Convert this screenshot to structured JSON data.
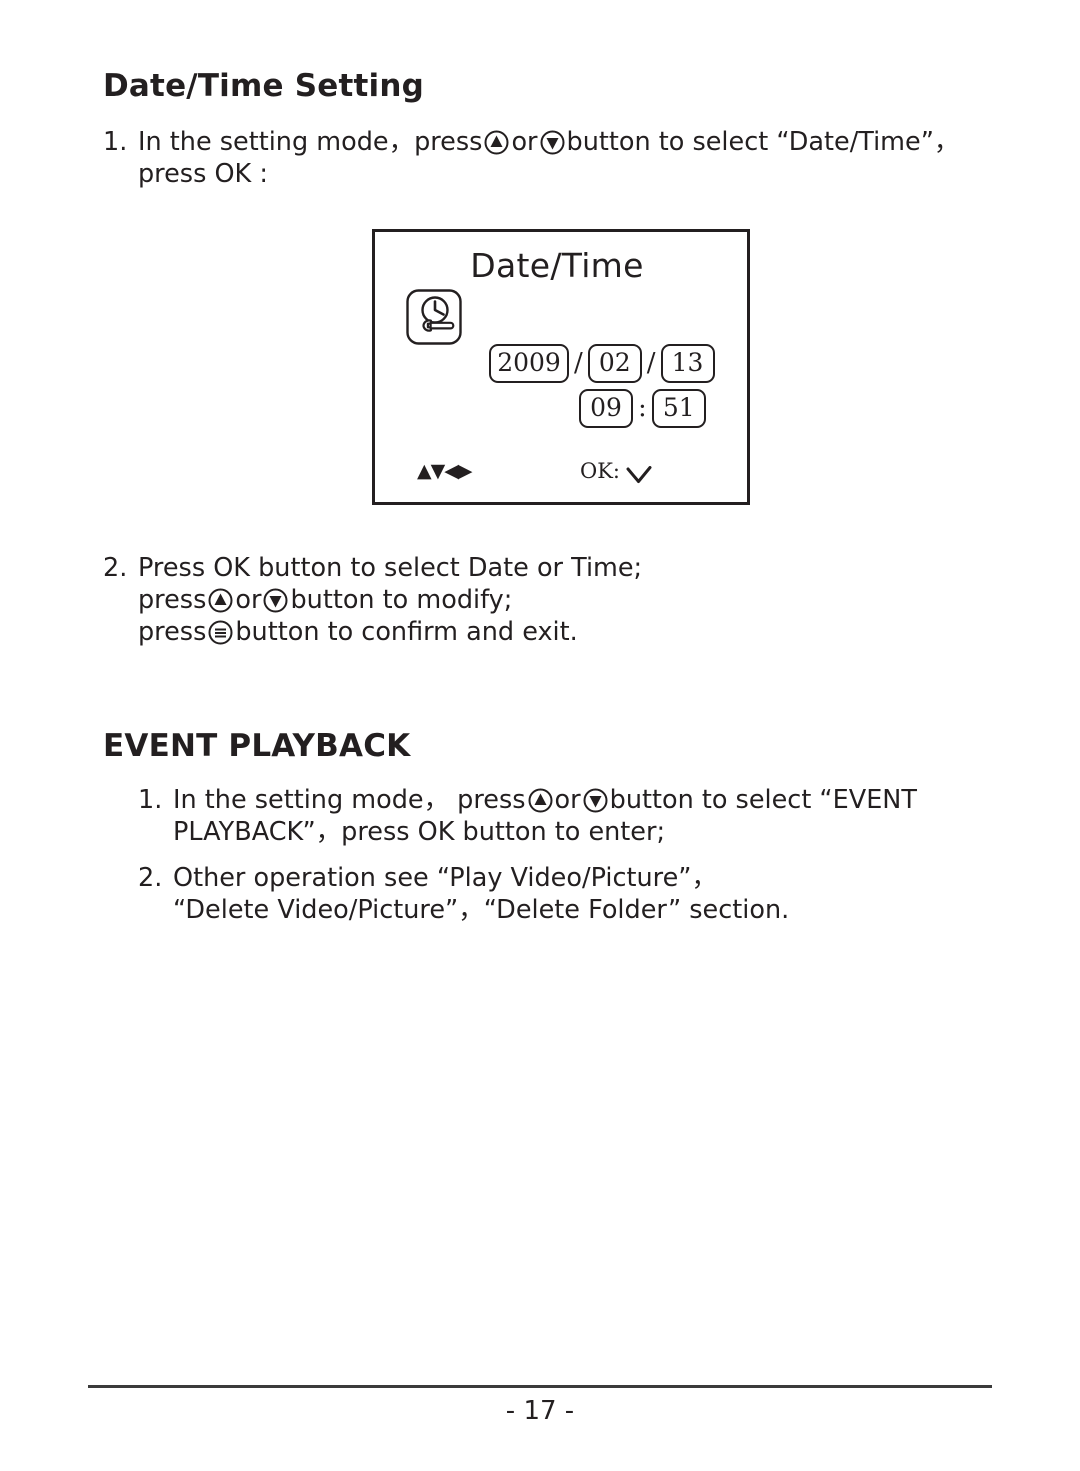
{
  "document": {
    "page_number": "- 17 -"
  },
  "sections": {
    "date_time": {
      "heading": "Date/Time Setting",
      "step1": {
        "number": "1.",
        "line1_a": "In the setting mode，press",
        "icon_up": "up-button-icon",
        "line1_b": "or",
        "icon_down": "down-button-icon",
        "line1_c": "button to select “Date/Time”，",
        "line2": "press OK :"
      },
      "step2": {
        "number": "2.",
        "line1": "Press OK button to select Date or Time;",
        "line2_a": "press",
        "line2_b": "or",
        "line2_c": "button to modify;",
        "line3_a": "press",
        "line3_b": "button to confirm and exit.",
        "icon_menu": "menu-button-icon"
      }
    },
    "event_playback": {
      "heading": "EVENT PLAYBACK",
      "step1": {
        "number": "1.",
        "line1_a": "In the setting mode， press",
        "line1_b": "or",
        "line1_c": "button to select “EVENT",
        "line2": "PLAYBACK”，press OK button to enter;"
      },
      "step2": {
        "number": "2.",
        "line1": "Other operation see  “Play Video/Picture”，",
        "line2": "“Delete Video/Picture”，“Delete Folder” section."
      }
    }
  },
  "lcd_screen": {
    "title": "Date/Time",
    "icon": "clock-wrench-icon",
    "date": {
      "year": "2009",
      "separator1": "/",
      "month": "02",
      "separator2": "/",
      "day": "13"
    },
    "time": {
      "hour": "09",
      "separator": ":",
      "minute": "51"
    },
    "footer": {
      "nav_arrows": "▲▼◀▶",
      "ok_label": "OK:",
      "ok_icon": "checkmark-icon"
    }
  },
  "colors": {
    "ink": "#231f20",
    "rule": "#3b3b3b",
    "paper": "#ffffff"
  }
}
